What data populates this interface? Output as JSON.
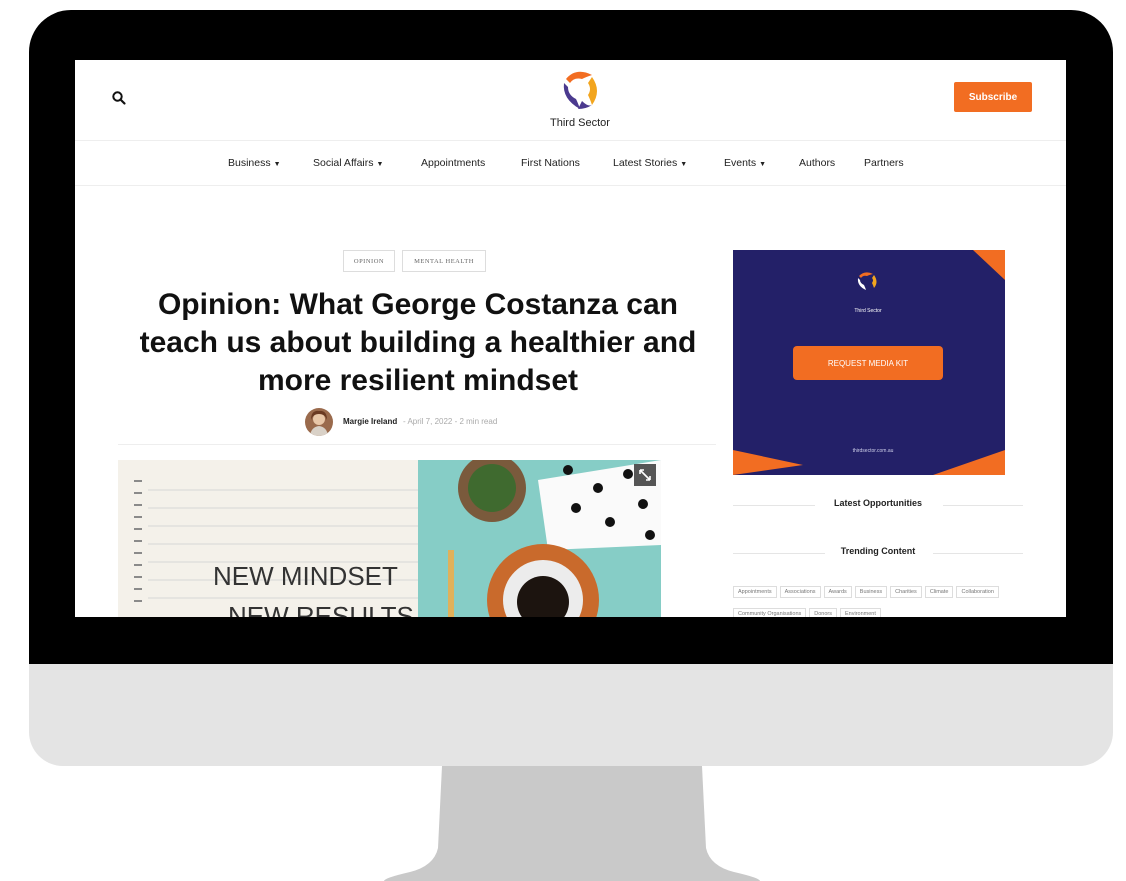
{
  "header": {
    "site_name": "Third Sector",
    "subscribe_label": "Subscribe"
  },
  "nav": {
    "items": [
      {
        "label": "Business",
        "has_dropdown": true
      },
      {
        "label": "Social Affairs",
        "has_dropdown": true
      },
      {
        "label": "Appointments",
        "has_dropdown": false
      },
      {
        "label": "First Nations",
        "has_dropdown": false
      },
      {
        "label": "Latest Stories",
        "has_dropdown": true
      },
      {
        "label": "Events",
        "has_dropdown": true
      },
      {
        "label": "Authors",
        "has_dropdown": false
      },
      {
        "label": "Partners",
        "has_dropdown": false
      }
    ]
  },
  "article": {
    "tags": [
      "OPINION",
      "MENTAL HEALTH"
    ],
    "title": "Opinion: What George Costanza can teach us about building a healthier and more resilient mindset",
    "author": "Margie Ireland",
    "meta": "- April 7, 2022 - 2 min read",
    "hero_text_line1": "NEW MINDSET",
    "hero_text_line2": "NEW RESULTS"
  },
  "sidebar": {
    "ad": {
      "brand": "Third Sector",
      "button_label": "REQUEST MEDIA KIT",
      "url": "thirdsector.com.au"
    },
    "latest_heading": "Latest Opportunities",
    "trending_heading": "Trending Content",
    "trending_tags": [
      "Appointments",
      "Associations",
      "Awards",
      "Business",
      "Charities",
      "Climate",
      "Collaboration",
      "Community Organisations",
      "Donors",
      "Environment"
    ]
  },
  "colors": {
    "accent": "#f26d22",
    "ad_background": "#232068",
    "logo_purple": "#4b3a8f",
    "logo_gold": "#f2a51e"
  }
}
